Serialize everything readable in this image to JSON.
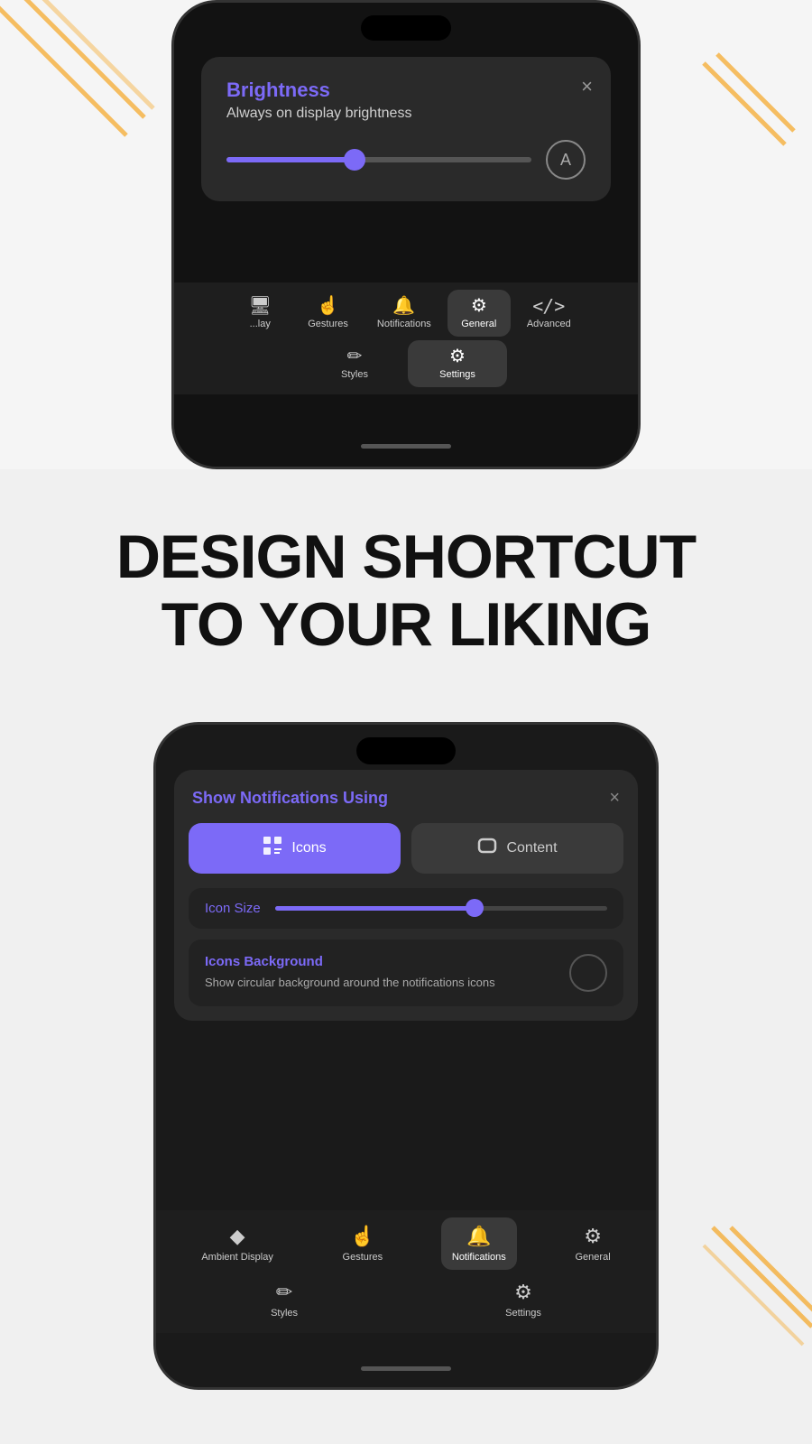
{
  "topSection": {
    "dialog": {
      "title": "Brightness",
      "subtitle": "Always on display brightness",
      "closeLabel": "×",
      "sliderValue": 42,
      "autoBrightnessLabel": "A"
    },
    "tabs": {
      "row1": [
        {
          "id": "display",
          "label": "Display",
          "icon": "🖥",
          "active": false,
          "truncated": true
        },
        {
          "id": "gestures",
          "label": "Gestures",
          "icon": "☝",
          "active": false
        },
        {
          "id": "notifications",
          "label": "Notifications",
          "icon": "🔔",
          "active": false
        },
        {
          "id": "general",
          "label": "General",
          "icon": "⚙",
          "active": true
        },
        {
          "id": "advanced",
          "label": "Advanced",
          "icon": "</>",
          "active": false
        }
      ],
      "row2": [
        {
          "id": "styles",
          "label": "Styles",
          "icon": "✏",
          "active": false
        },
        {
          "id": "settings",
          "label": "Settings",
          "icon": "⚙",
          "active": true
        }
      ]
    }
  },
  "headline": {
    "line1": "DESIGN SHORTCUT",
    "line2": "TO YOUR LIKING"
  },
  "bottomSection": {
    "dialog": {
      "title": "Show Notifications Using",
      "closeLabel": "×",
      "toggleButtons": [
        {
          "id": "icons",
          "label": "Icons",
          "icon": "⊞",
          "active": true
        },
        {
          "id": "content",
          "label": "Content",
          "icon": "⬜",
          "active": false
        }
      ],
      "iconSize": {
        "label": "Icon Size",
        "sliderValue": 60
      },
      "iconsBackground": {
        "title": "Icons Background",
        "description": "Show circular background around the notifications icons",
        "toggleState": false
      }
    },
    "tabs": {
      "row1": [
        {
          "id": "ambient",
          "label": "Ambient Display",
          "icon": "◆",
          "active": false
        },
        {
          "id": "gestures",
          "label": "Gestures",
          "icon": "☝",
          "active": false
        },
        {
          "id": "notifications",
          "label": "Notifications",
          "icon": "🔔",
          "active": true
        },
        {
          "id": "general",
          "label": "General",
          "icon": "⚙",
          "active": false
        }
      ],
      "row2": [
        {
          "id": "styles",
          "label": "Styles",
          "icon": "✏",
          "active": false
        },
        {
          "id": "settings",
          "label": "Settings",
          "icon": "⚙",
          "active": false
        }
      ]
    }
  }
}
